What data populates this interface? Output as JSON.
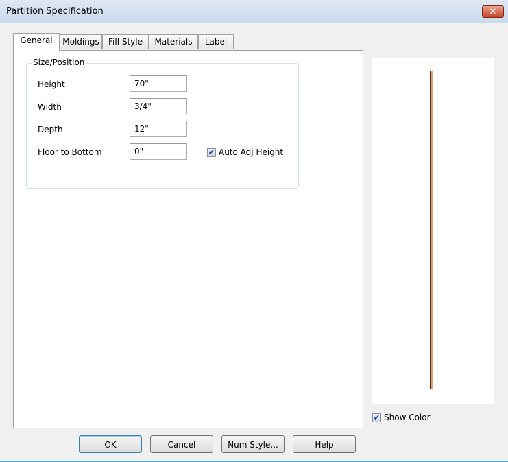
{
  "window": {
    "title": "Partition Specification",
    "close_glyph": "✕"
  },
  "tabs": [
    {
      "label": "General"
    },
    {
      "label": "Moldings"
    },
    {
      "label": "Fill Style"
    },
    {
      "label": "Materials"
    },
    {
      "label": "Label"
    }
  ],
  "size_position": {
    "legend": "Size/Position",
    "height": {
      "label": "Height",
      "value": "70\""
    },
    "width": {
      "label": "Width",
      "value": "3/4\""
    },
    "depth": {
      "label": "Depth",
      "value": "12\""
    },
    "floor_to_bottom": {
      "label": "Floor to Bottom",
      "value": "0\""
    },
    "auto_adj_height": {
      "label": "Auto Adj Height",
      "checked": true
    }
  },
  "preview": {
    "show_color": {
      "label": "Show Color",
      "checked": true
    },
    "partition_color": "#e0a070"
  },
  "buttons": {
    "ok": "OK",
    "cancel": "Cancel",
    "num_style": "Num Style...",
    "help": "Help"
  }
}
